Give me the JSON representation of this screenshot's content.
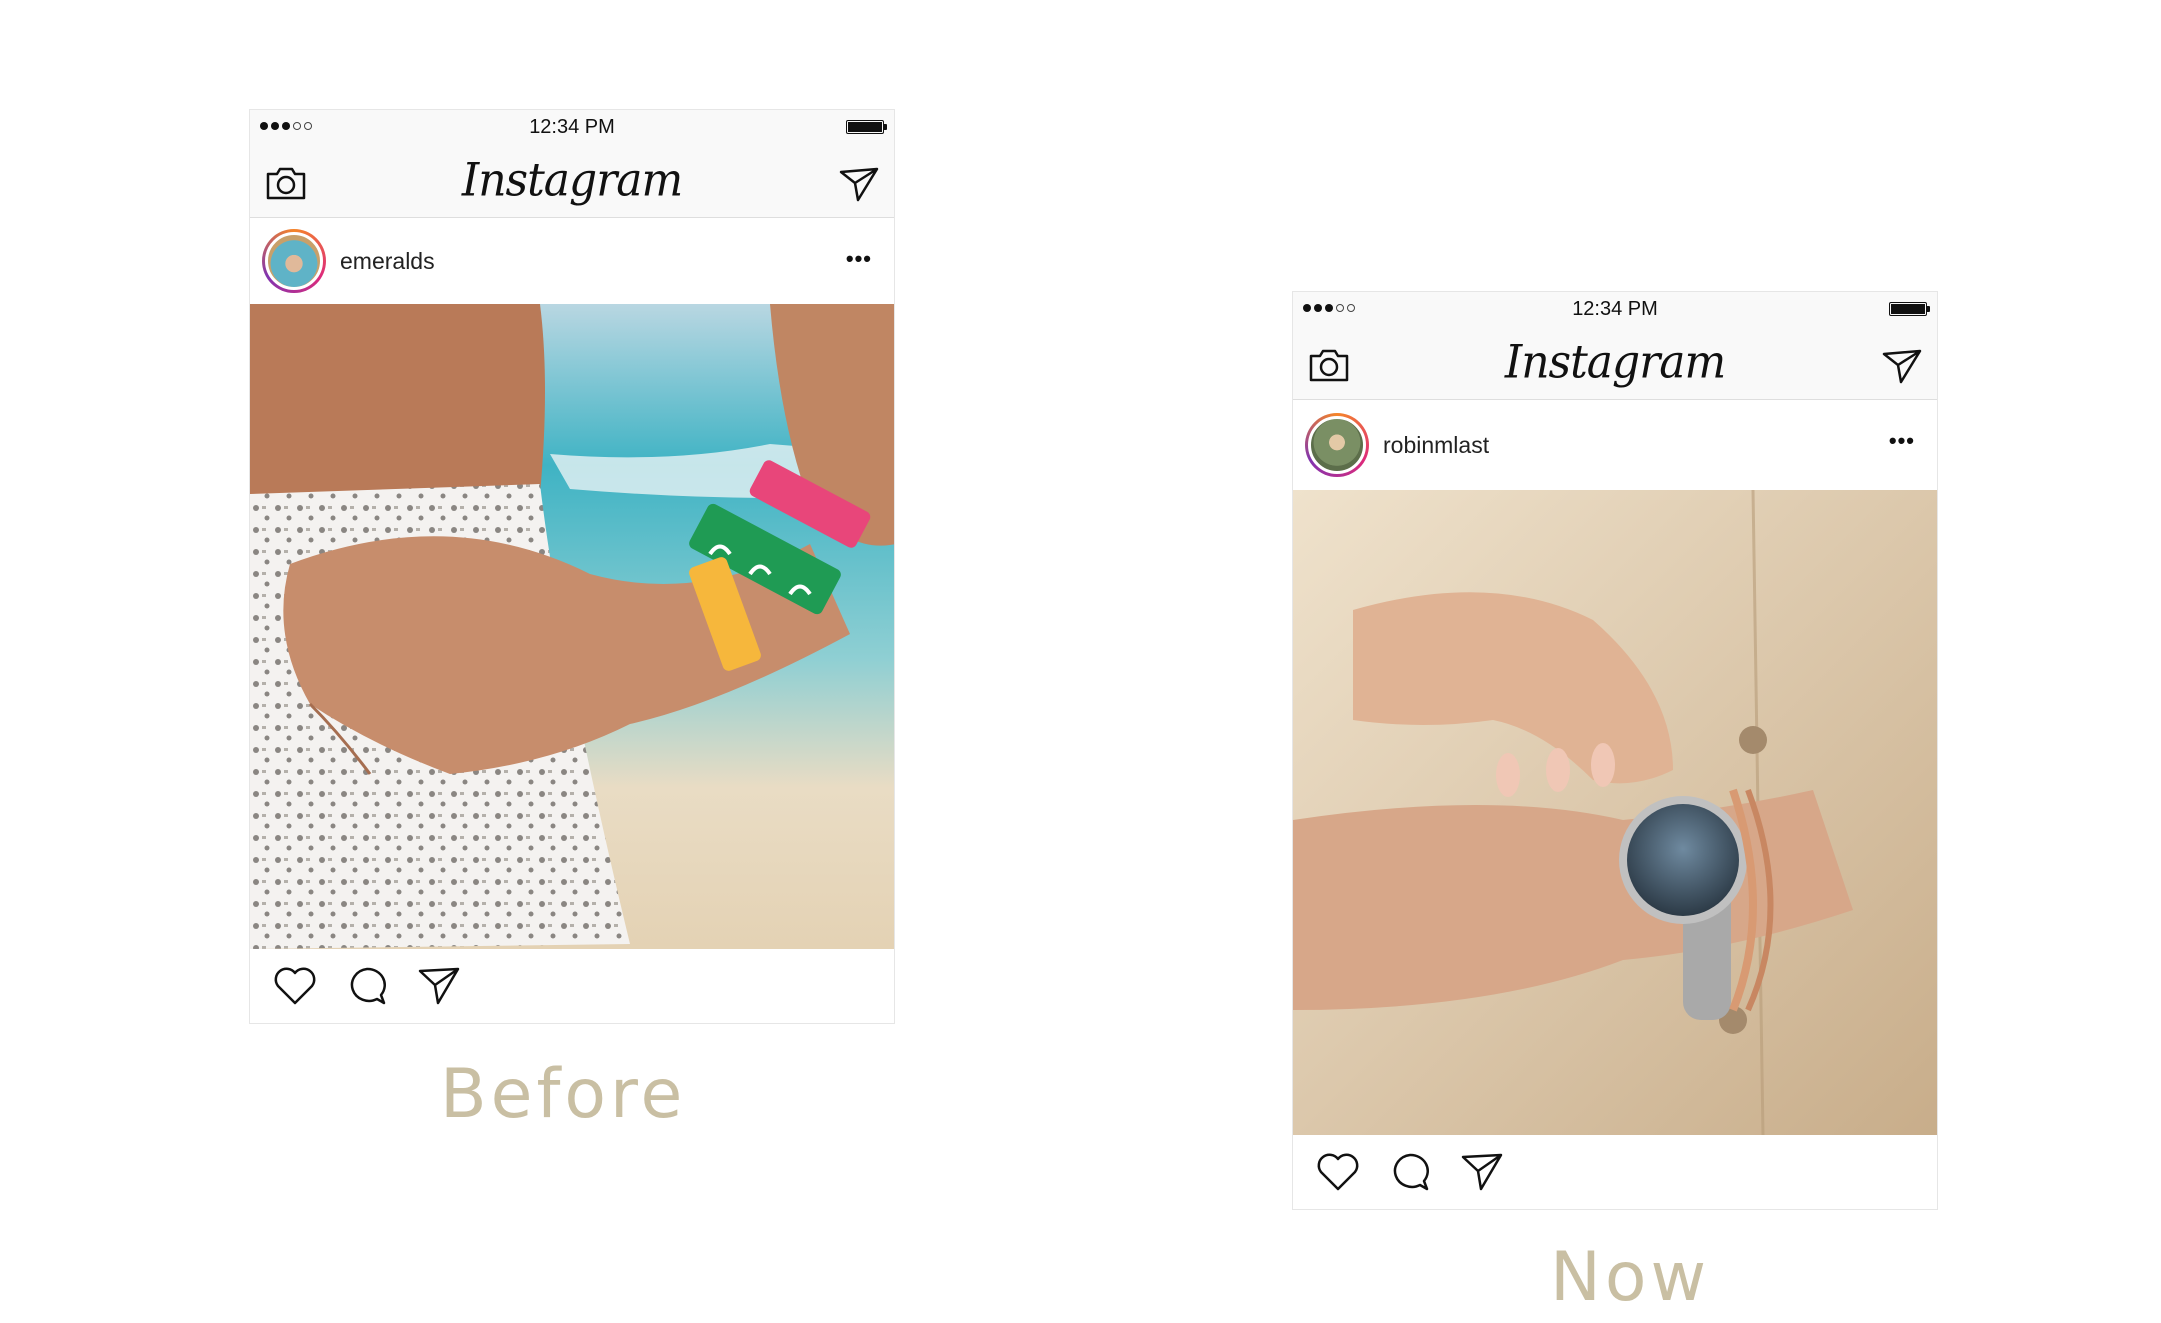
{
  "before": {
    "status_time": "12:34 PM",
    "app_title": "Instagram",
    "username": "emeralds",
    "more_label": "•••",
    "caption": "Before"
  },
  "now": {
    "status_time": "12:34 PM",
    "app_title": "Instagram",
    "username": "robinmlast",
    "more_label": "•••",
    "caption": "Now"
  },
  "icons": {
    "camera": "camera-icon",
    "direct": "paper-plane-icon",
    "like": "heart-icon",
    "comment": "comment-bubble-icon",
    "share": "paper-plane-icon"
  },
  "colors": {
    "caption": "#c9bfa3",
    "bar_background": "#f9f9f9",
    "border": "#e6e6e6"
  }
}
